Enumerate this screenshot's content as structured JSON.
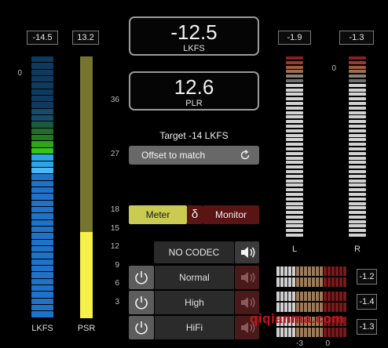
{
  "left_meters": {
    "lkfs_readout": "-14.5",
    "psr_readout": "13.2",
    "lkfs_label": "LKFS",
    "psr_label": "PSR",
    "scale_zero": "0",
    "lkfs_segments": [
      "#0f3a5e",
      "#0f3a5e",
      "#0f3a5e",
      "#0f3a5e",
      "#0f3a5e",
      "#0f3a5e",
      "#0f3a5e",
      "#0f3a5e",
      "#184a6c",
      "#184a6c",
      "#1a5a3a",
      "#1f6e2c",
      "#1f7a1f",
      "#2ea51c",
      "#38c21c",
      "#2aa6e6",
      "#2aa6e6",
      "#4cb8f2",
      "#1e72c8",
      "#1e72c8",
      "#1e72c8",
      "#1e72c8",
      "#1e72c8",
      "#1e72c8",
      "#1e72c8",
      "#1e72c8",
      "#1e72c8",
      "#1e72c8",
      "#1e72c8",
      "#1e72c8",
      "#1e72c8",
      "#1e72c8",
      "#1e72c8",
      "#1e72c8",
      "#1e72c8",
      "#1e72c8",
      "#1e72c8",
      "#1e72c8",
      "#1e72c8",
      "#1e72c8"
    ],
    "psr_fill_level": 0.33,
    "psr_colors": {
      "empty": "#757530",
      "fill": "#f5f04a"
    }
  },
  "scale": [
    "36",
    "27",
    "18",
    "15",
    "12",
    "9",
    "6",
    "3"
  ],
  "loudness": {
    "value": "-12.5",
    "unit": "LKFS"
  },
  "plr": {
    "value": "12.6",
    "unit": "PLR"
  },
  "target": {
    "text": "Target -14 LKFS"
  },
  "offset_button": {
    "label": "Offset to match",
    "icon": "refresh-icon"
  },
  "mode_toggle": {
    "meter_label": "Meter",
    "delta_label": "δ",
    "monitor_label": "Monitor"
  },
  "codec": {
    "label": "NO CODEC",
    "icon": "speaker-icon"
  },
  "codec_rows": [
    {
      "label": "Normal",
      "icon": "power-icon"
    },
    {
      "label": "High",
      "icon": "power-icon"
    },
    {
      "label": "HiFi",
      "icon": "power-icon"
    }
  ],
  "right_meters": {
    "l_readout": "-1.9",
    "r_readout": "-1.3",
    "l_label": "L",
    "r_label": "R",
    "scale_zero": "0",
    "top_colors": [
      "#8a1f1f",
      "#9a3a2a",
      "#a05a3a",
      "#9c6e50",
      "#8a8078",
      "#707070"
    ]
  },
  "small_meters": {
    "readouts": [
      "-1.2",
      "-1.4",
      "-1.3"
    ],
    "bottom_scale": [
      "-3",
      "0"
    ]
  },
  "watermark": "qiqianma.com"
}
